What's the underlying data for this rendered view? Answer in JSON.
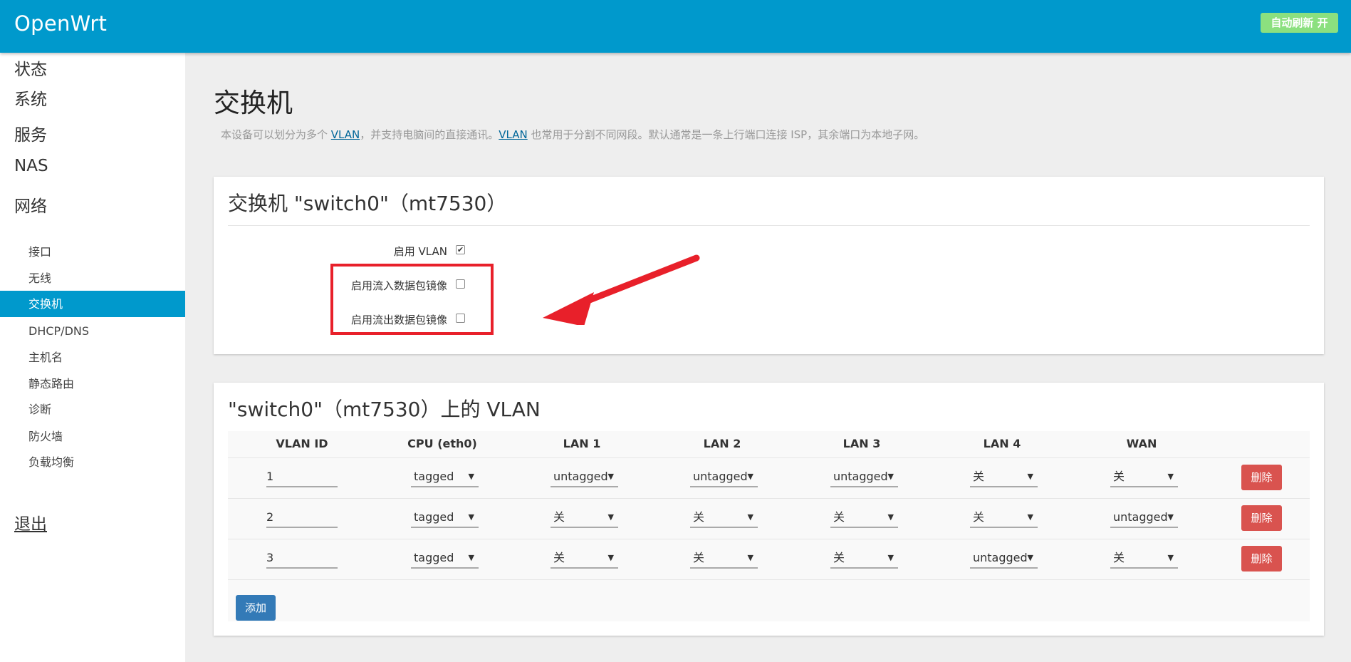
{
  "header": {
    "brand": "OpenWrt",
    "auto_refresh": "自动刷新 开"
  },
  "sidebar": {
    "top_items": [
      "状态",
      "系统",
      "服务",
      "NAS",
      "网络"
    ],
    "sub_items": [
      "接口",
      "无线",
      "交换机",
      "DHCP/DNS",
      "主机名",
      "静态路由",
      "诊断",
      "防火墙",
      "负载均衡"
    ],
    "active_sub": "交换机",
    "logout": "退出"
  },
  "page": {
    "title": "交换机",
    "desc_1": "本设备可以划分为多个 ",
    "desc_link1": "VLAN",
    "desc_2": "，并支持电脑间的直接通讯。",
    "desc_link2": "VLAN",
    "desc_3": " 也常用于分割不同网段。默认通常是一条上行端口连接 ISP，其余端口为本地子网。"
  },
  "switch_panel": {
    "title": "交换机 \"switch0\"（mt7530）",
    "options": [
      {
        "label": "启用 VLAN",
        "checked": true
      },
      {
        "label": "启用流入数据包镜像",
        "checked": false
      },
      {
        "label": "启用流出数据包镜像",
        "checked": false
      }
    ],
    "check_mark": "✔"
  },
  "vlan_panel": {
    "title": "\"switch0\"（mt7530）上的 VLAN",
    "columns": [
      "VLAN ID",
      "CPU (eth0)",
      "LAN 1",
      "LAN 2",
      "LAN 3",
      "LAN 4",
      "WAN"
    ],
    "rows": [
      {
        "id": "1",
        "ports": [
          "tagged",
          "untagged",
          "untagged",
          "untagged",
          "关",
          "关"
        ]
      },
      {
        "id": "2",
        "ports": [
          "tagged",
          "关",
          "关",
          "关",
          "关",
          "untagged"
        ]
      },
      {
        "id": "3",
        "ports": [
          "tagged",
          "关",
          "关",
          "关",
          "untagged",
          "关"
        ]
      }
    ],
    "caret": "▼",
    "delete_label": "删除",
    "add_label": "添加"
  },
  "colors": {
    "brand_blue": "#0099cc",
    "highlight_red": "#e8202a",
    "danger": "#d9534f",
    "primary": "#337ab7"
  }
}
